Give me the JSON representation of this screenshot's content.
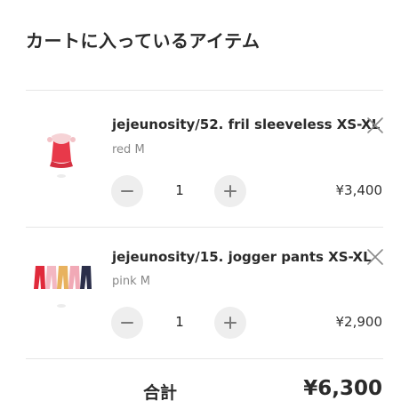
{
  "page": {
    "title": "カートに入っているアイテム"
  },
  "cart": {
    "items": [
      {
        "name": "jejeunosity/52. fril sleeveless XS-XL",
        "variant": "red M",
        "quantity": "1",
        "price": "¥3,400",
        "thumbnail_icon": "red-sleeveless-top-thumbnail"
      },
      {
        "name": "jejeunosity/15. jogger pants XS-XL",
        "variant": "pink M",
        "quantity": "1",
        "price": "¥2,900",
        "thumbnail_icon": "jogger-pants-thumbnail"
      }
    ],
    "total_label": "合計",
    "total_value": "¥6,300"
  },
  "icons": {
    "remove": "close-icon",
    "decrement": "minus-icon",
    "increment": "plus-icon"
  },
  "colors": {
    "accent_red": "#e8394a",
    "button_bg": "#eeeeee",
    "icon_gray": "#8a8a8a"
  }
}
